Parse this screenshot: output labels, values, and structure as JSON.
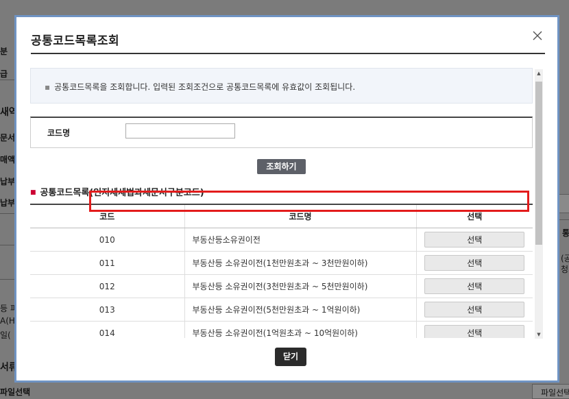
{
  "background": {
    "fragments": [
      "분",
      "급",
      "새역",
      "문서",
      "매액",
      "납부",
      "납부",
      "등 피",
      "A(H",
      "일(",
      "서류",
      "파일선택",
      "파일선택",
      "통",
      "(공",
      "청서"
    ]
  },
  "dialog": {
    "title": "공통코드목록조회",
    "close_icon": "close-icon",
    "notice": "공통코드목록을 조회합니다. 입력된 조회조건으로 공통코드목록에 유효값이 조회됩니다.",
    "search": {
      "label": "코드명",
      "value": "",
      "placeholder": "",
      "button": "조회하기"
    },
    "section_title": "공통코드목록(인지세세법과세문서구분코드)",
    "table": {
      "headers": [
        "코드",
        "코드명",
        "선택"
      ],
      "rows": [
        {
          "code": "010",
          "name": "부동산등소유권이전",
          "select": "선택"
        },
        {
          "code": "011",
          "name": "부동산등 소유권이전(1천만원초과 ~ 3천만원이하)",
          "select": "선택"
        },
        {
          "code": "012",
          "name": "부동산등 소유권이전(3천만원초과 ~ 5천만원이하)",
          "select": "선택"
        },
        {
          "code": "013",
          "name": "부동산등 소유권이전(5천만원초과 ~ 1억원이하)",
          "select": "선택"
        },
        {
          "code": "014",
          "name": "부동산등 소유권이전(1억원초과 ~ 10억원이하)",
          "select": "선택"
        }
      ]
    },
    "close_button": "닫기",
    "colors": {
      "border": "#6f93c3",
      "highlight": "#e31b1b",
      "button_dark": "#5d6068"
    }
  }
}
